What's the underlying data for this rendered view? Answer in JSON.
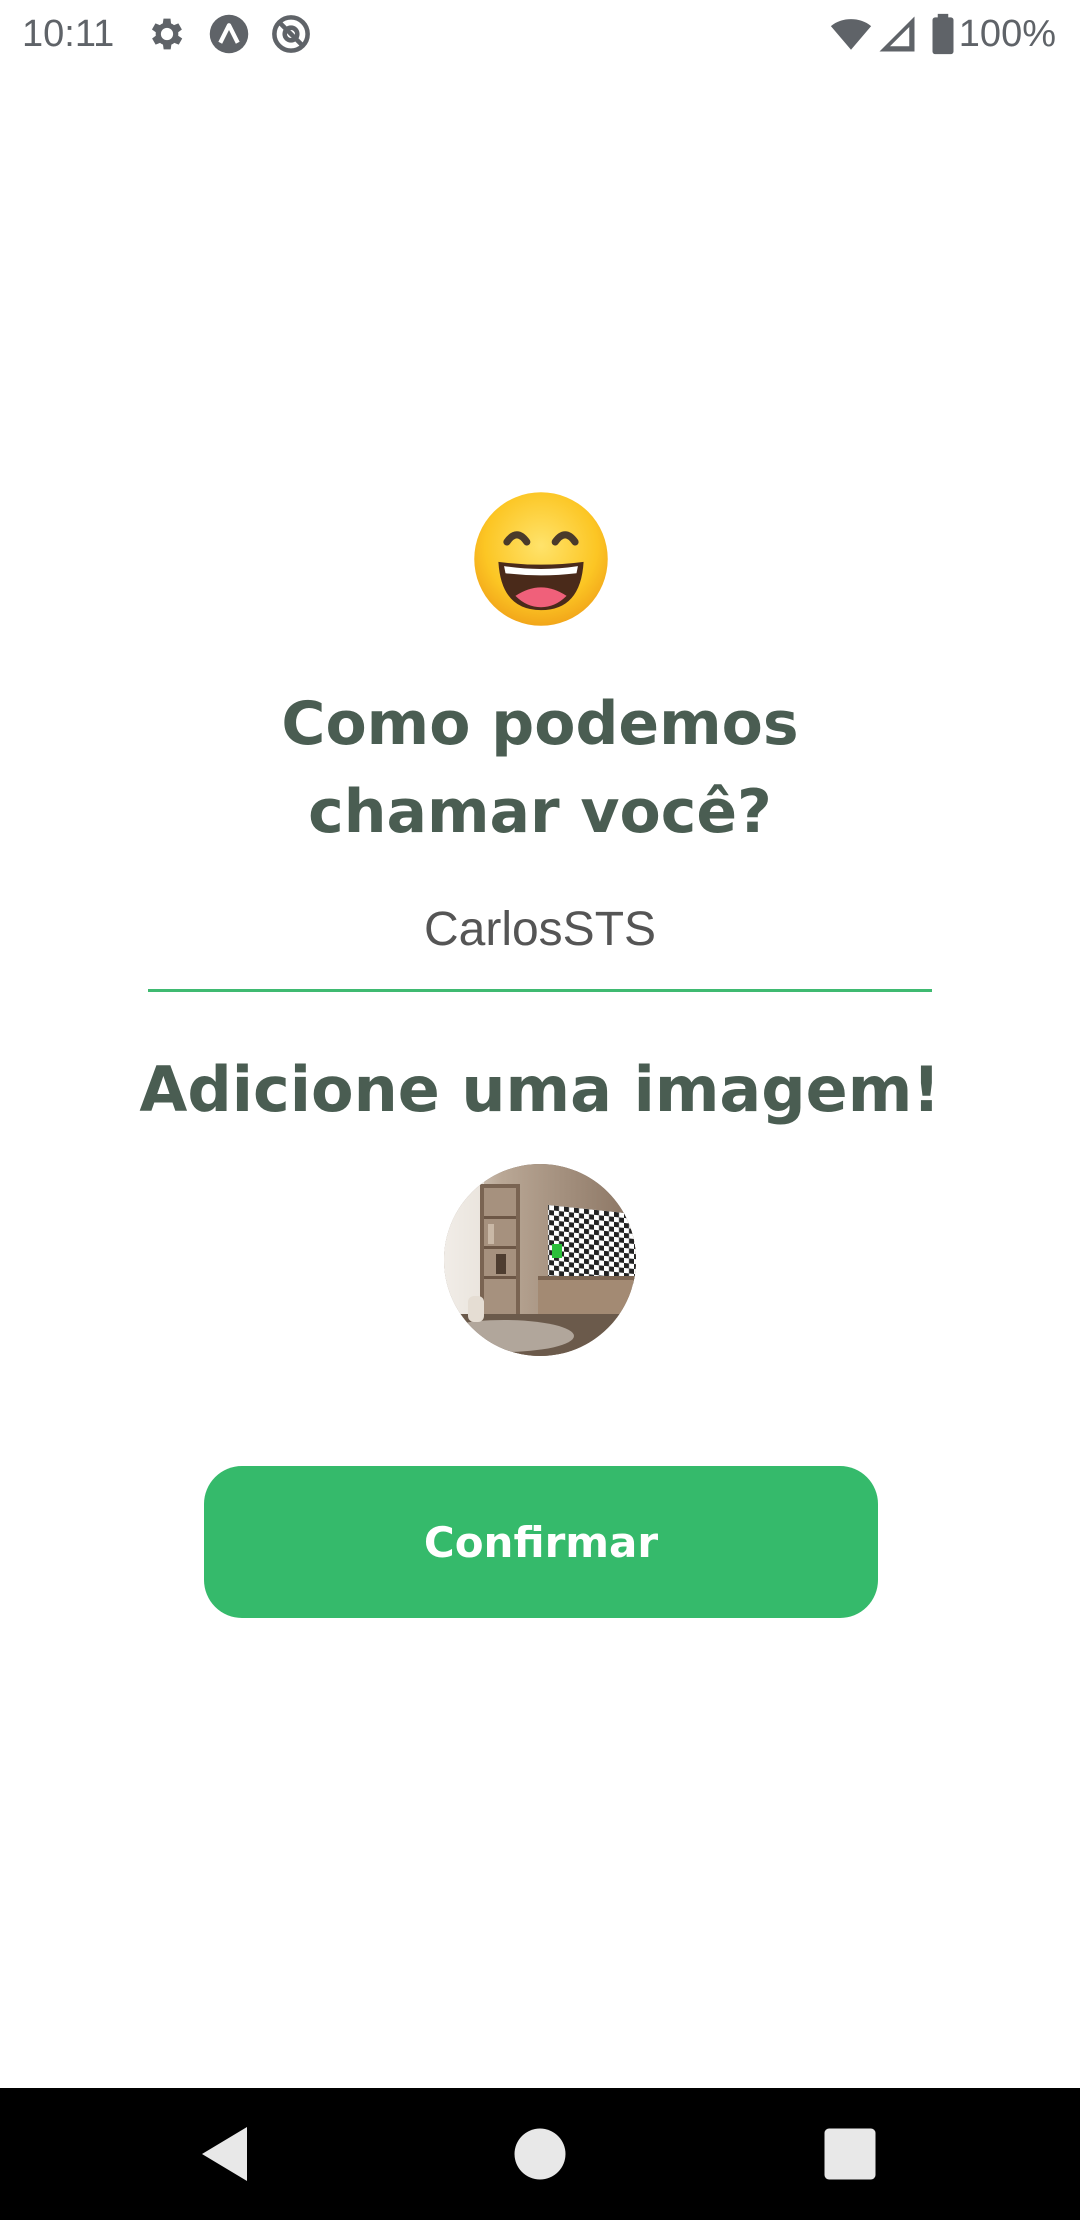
{
  "status_bar": {
    "time": "10:11",
    "battery": "100%",
    "icons": [
      "gear-icon",
      "expo-icon",
      "at-sign-icon",
      "wifi-icon",
      "signal-icon",
      "battery-icon"
    ]
  },
  "profile_setup": {
    "emoji": "grinning-face-icon",
    "title_line1": "Como podemos",
    "title_line2": "chamar você?",
    "name_value": "CarlosSTS",
    "image_heading": "Adicione uma imagem!",
    "confirm_label": "Confirmar"
  },
  "nav_bar": {
    "icons": [
      "back-icon",
      "home-icon",
      "recents-icon"
    ]
  },
  "colors": {
    "accent": "#35ba6b",
    "title_text": "#4a5d52",
    "underline": "#3fba71"
  }
}
